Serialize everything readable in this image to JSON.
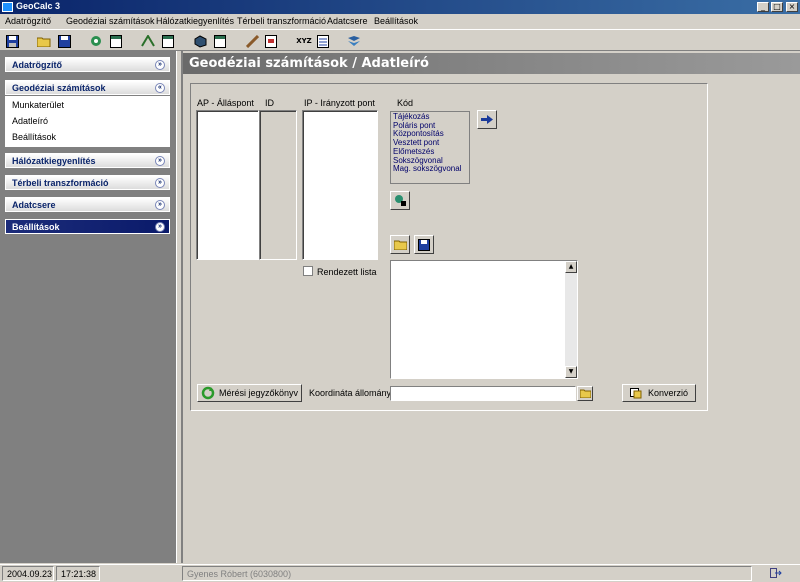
{
  "window": {
    "title": "GeoCalc 3",
    "icon": "app-icon",
    "controls": [
      "_",
      "□",
      "×"
    ]
  },
  "menu": [
    "Adatrögzítő",
    "Geodéziai számítások",
    "Hálózatkiegyenlítés",
    "Térbeli transzformáció",
    "Adatcsere",
    "Beállítások"
  ],
  "sidebar": {
    "groups": [
      {
        "label": "Adatrögzítő",
        "chevron": "»"
      },
      {
        "label": "Geodéziai számítások",
        "chevron": "«"
      },
      {
        "label": "Hálózatkiegyenlítés",
        "chevron": "»"
      },
      {
        "label": "Térbeli transzformáció",
        "chevron": "»"
      },
      {
        "label": "Adatcsere",
        "chevron": "»"
      },
      {
        "label": "Beállítások",
        "chevron": "»"
      }
    ],
    "sub_items": [
      "Munkaterület",
      "Adatleíró",
      "Beállítások"
    ]
  },
  "main": {
    "header_title": "Geodéziai számítások / Adatleíró",
    "col_ap": "AP - Álláspont",
    "col_id": "ID",
    "col_ip": "IP - Irányzott pont",
    "col_kod": "Kód",
    "kod_items": [
      "Tájékozás",
      "Poláris pont",
      "Központosítás",
      "Vesztett pont",
      "Előmetszés",
      "Sokszögvonal",
      "Mag. sokszögvonal"
    ],
    "sorted_list_label": "Rendezett lista",
    "sorted_list_checked": false,
    "meres_button": "Mérési jegyzőkönyv",
    "coord_label": "Koordináta állomány:",
    "coord_value": "",
    "convert_button": "Konverzió"
  },
  "status": {
    "date": "2004.09.23",
    "time": "17:21:38",
    "user": "Gyenes Róbert (6030800)"
  },
  "colors": {
    "title_bar": "#0a246a",
    "kod_text": "#00006a",
    "active_group": "#0a1a6a"
  }
}
